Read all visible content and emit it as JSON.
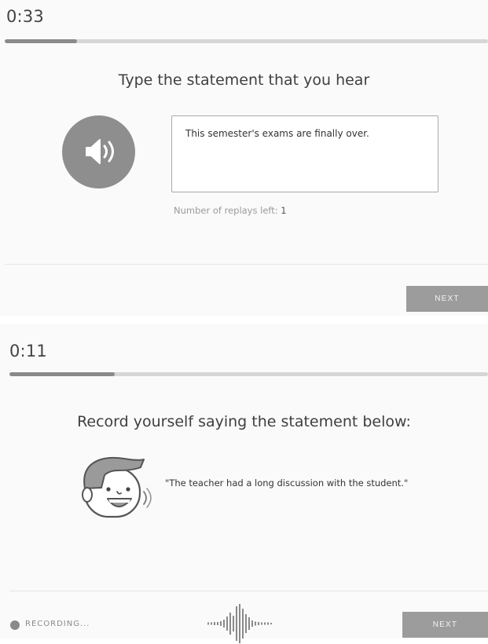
{
  "question1": {
    "timer": "0:33",
    "progress": 0.15,
    "heading": "Type the statement that you hear",
    "answer_text": "This semester's exams are finally over.",
    "replays_label": "Number of replays left:",
    "replays_count": "1",
    "next_label": "NEXT"
  },
  "question2": {
    "timer": "0:11",
    "progress": 0.22,
    "heading": "Record yourself saying the statement below:",
    "statement": "\"The teacher had a long discussion with the student.\"",
    "recording_label": "RECORDING...",
    "next_label": "NEXT"
  },
  "colors": {
    "background": "#fafafa",
    "progress_fill": "#8a8a8a",
    "progress_track": "#d6d6d6",
    "button": "#9c9c9c"
  },
  "icons": {
    "speaker": "speaker-volume-icon",
    "character": "speaking-character-icon",
    "waveform": "audio-waveform-icon",
    "recording": "recording-dot-icon"
  }
}
